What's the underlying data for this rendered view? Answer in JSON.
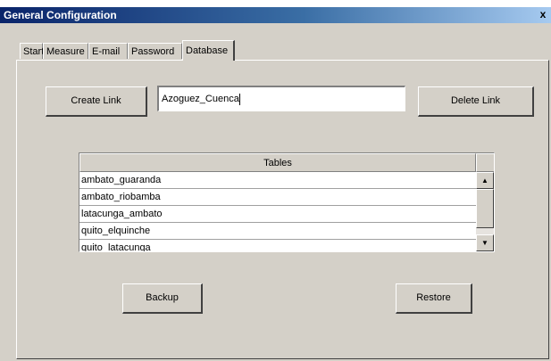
{
  "window": {
    "title": "General Configuration",
    "close_symbol": "x"
  },
  "tabs": [
    {
      "label": "Start"
    },
    {
      "label": "Measure"
    },
    {
      "label": "E-mail"
    },
    {
      "label": "Password"
    },
    {
      "label": "Database",
      "active": true
    }
  ],
  "database": {
    "create_link_label": "Create Link",
    "link_name_value": "Azoguez_Cuenca",
    "delete_link_label": "Delete Link",
    "tables_header": "Tables",
    "tables": [
      "ambato_guaranda",
      "ambato_riobamba",
      "latacunga_ambato",
      "quito_elquinche",
      "quito_latacunga"
    ],
    "scroll_up_icon": "arrow-up-icon",
    "scroll_down_icon": "arrow-down-icon",
    "backup_label": "Backup",
    "restore_label": "Restore"
  }
}
